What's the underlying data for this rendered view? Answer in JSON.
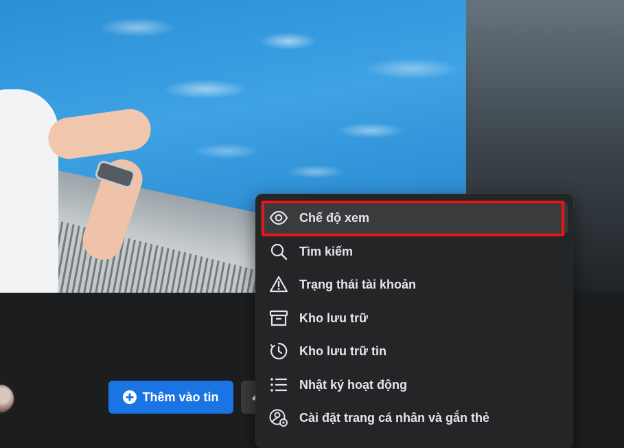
{
  "profile": {
    "add_story_label": "Thêm vào tin",
    "add_story_icon": "plus-circle-icon",
    "edit_icon": "pencil-icon"
  },
  "menu": {
    "items": [
      {
        "label": "Chế độ xem",
        "icon": "eye-icon",
        "active": true
      },
      {
        "label": "Tìm kiếm",
        "icon": "search-icon"
      },
      {
        "label": "Trạng thái tài khoản",
        "icon": "warning-triangle-icon"
      },
      {
        "label": "Kho lưu trữ",
        "icon": "archive-box-icon"
      },
      {
        "label": "Kho lưu trữ tin",
        "icon": "story-archive-clock-icon"
      },
      {
        "label": "Nhật ký hoạt động",
        "icon": "list-icon"
      },
      {
        "label": "Cài đặt trang cá nhân và gắn thẻ",
        "icon": "profile-settings-icon"
      }
    ]
  },
  "colors": {
    "background": "#1c1d1f",
    "menu_background": "#242526",
    "menu_hover": "#3a3b3c",
    "menu_text": "#e4e6eb",
    "primary_button": "#1b74e4",
    "highlight_outline": "#e8141c"
  }
}
